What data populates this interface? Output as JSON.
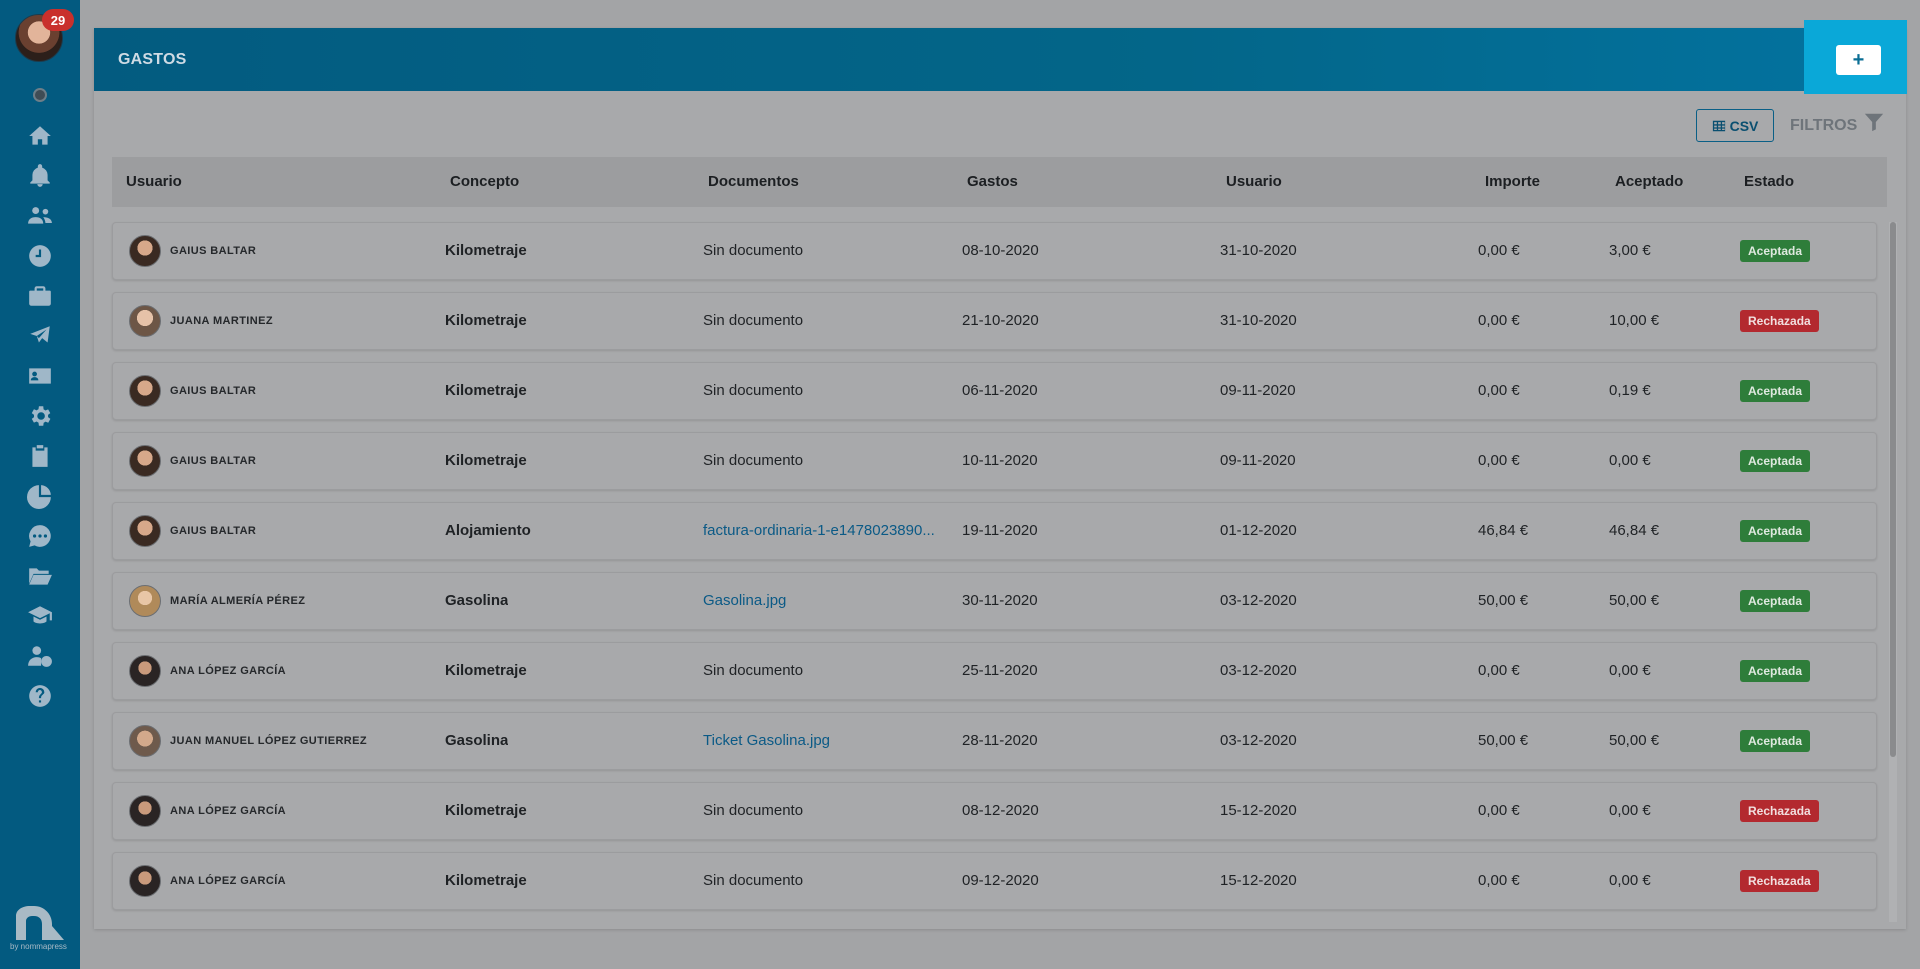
{
  "sidebar": {
    "notifications_count": "29",
    "brand_text": "by nommapress",
    "icons": [
      "home-icon",
      "bell-icon",
      "users-icon",
      "clock-icon",
      "briefcase-icon",
      "plane-icon",
      "id-card-icon",
      "gear-icon",
      "clipboard-icon",
      "pie-chart-icon",
      "chat-icon",
      "folder-icon",
      "graduation-icon",
      "user-money-icon",
      "help-icon"
    ]
  },
  "header": {
    "title": "GASTOS",
    "add_label": "+"
  },
  "toolbar": {
    "csv_label": "CSV",
    "filters_label": "FILTROS"
  },
  "table": {
    "columns": [
      "Usuario",
      "Concepto",
      "Documentos",
      "Gastos",
      "Usuario",
      "Importe",
      "Aceptado",
      "Estado"
    ],
    "rows": [
      {
        "user": "GAIUS BALTAR",
        "concepto": "Kilometraje",
        "doc": "Sin documento",
        "doc_link": false,
        "gastos": "08-10-2020",
        "usuario": "31-10-2020",
        "importe": "0,00 €",
        "aceptado": "3,00 €",
        "estado": "Aceptada",
        "ok": true
      },
      {
        "user": "JUANA MARTINEZ",
        "concepto": "Kilometraje",
        "doc": "Sin documento",
        "doc_link": false,
        "gastos": "21-10-2020",
        "usuario": "31-10-2020",
        "importe": "0,00 €",
        "aceptado": "10,00 €",
        "estado": "Rechazada",
        "ok": false
      },
      {
        "user": "GAIUS BALTAR",
        "concepto": "Kilometraje",
        "doc": "Sin documento",
        "doc_link": false,
        "gastos": "06-11-2020",
        "usuario": "09-11-2020",
        "importe": "0,00 €",
        "aceptado": "0,19 €",
        "estado": "Aceptada",
        "ok": true
      },
      {
        "user": "GAIUS BALTAR",
        "concepto": "Kilometraje",
        "doc": "Sin documento",
        "doc_link": false,
        "gastos": "10-11-2020",
        "usuario": "09-11-2020",
        "importe": "0,00 €",
        "aceptado": "0,00 €",
        "estado": "Aceptada",
        "ok": true
      },
      {
        "user": "GAIUS BALTAR",
        "concepto": "Alojamiento",
        "doc": "factura-ordinaria-1-e1478023890...",
        "doc_link": true,
        "gastos": "19-11-2020",
        "usuario": "01-12-2020",
        "importe": "46,84 €",
        "aceptado": "46,84 €",
        "estado": "Aceptada",
        "ok": true
      },
      {
        "user": "MARÍA ALMERÍA PÉREZ",
        "concepto": "Gasolina",
        "doc": "Gasolina.jpg",
        "doc_link": true,
        "gastos": "30-11-2020",
        "usuario": "03-12-2020",
        "importe": "50,00 €",
        "aceptado": "50,00 €",
        "estado": "Aceptada",
        "ok": true
      },
      {
        "user": "ANA LÓPEZ GARCÍA",
        "concepto": "Kilometraje",
        "doc": "Sin documento",
        "doc_link": false,
        "gastos": "25-11-2020",
        "usuario": "03-12-2020",
        "importe": "0,00 €",
        "aceptado": "0,00 €",
        "estado": "Aceptada",
        "ok": true
      },
      {
        "user": "JUAN MANUEL LÓPEZ GUTIERREZ",
        "concepto": "Gasolina",
        "doc": "Ticket Gasolina.jpg",
        "doc_link": true,
        "gastos": "28-11-2020",
        "usuario": "03-12-2020",
        "importe": "50,00 €",
        "aceptado": "50,00 €",
        "estado": "Aceptada",
        "ok": true
      },
      {
        "user": "ANA LÓPEZ GARCÍA",
        "concepto": "Kilometraje",
        "doc": "Sin documento",
        "doc_link": false,
        "gastos": "08-12-2020",
        "usuario": "15-12-2020",
        "importe": "0,00 €",
        "aceptado": "0,00 €",
        "estado": "Rechazada",
        "ok": false
      },
      {
        "user": "ANA LÓPEZ GARCÍA",
        "concepto": "Kilometraje",
        "doc": "Sin documento",
        "doc_link": false,
        "gastos": "09-12-2020",
        "usuario": "15-12-2020",
        "importe": "0,00 €",
        "aceptado": "0,00 €",
        "estado": "Rechazada",
        "ok": false
      }
    ]
  },
  "colors": {
    "sidebar": "#035a80",
    "header": "#036689",
    "accent": "#0aa8d8",
    "accepted": "#2e7d3a",
    "rejected": "#b3292f"
  }
}
